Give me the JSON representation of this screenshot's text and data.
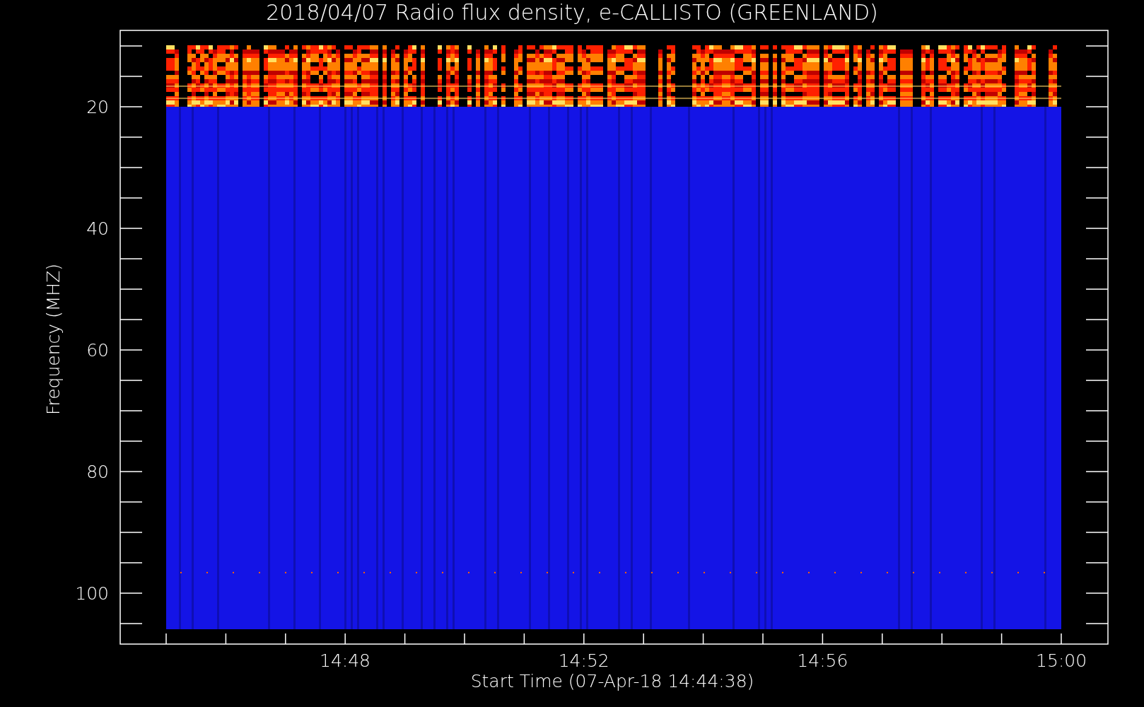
{
  "title": "2018/04/07  Radio flux density, e-CALLISTO (GREENLAND)",
  "y_axis": {
    "label": "Frequency (MHZ)",
    "ticks": [
      "20",
      "40",
      "60",
      "80",
      "100"
    ]
  },
  "x_axis": {
    "label": "Start Time (07-Apr-18 14:44:38)",
    "ticks": [
      "14:48",
      "14:52",
      "14:56",
      "15:00"
    ]
  }
}
